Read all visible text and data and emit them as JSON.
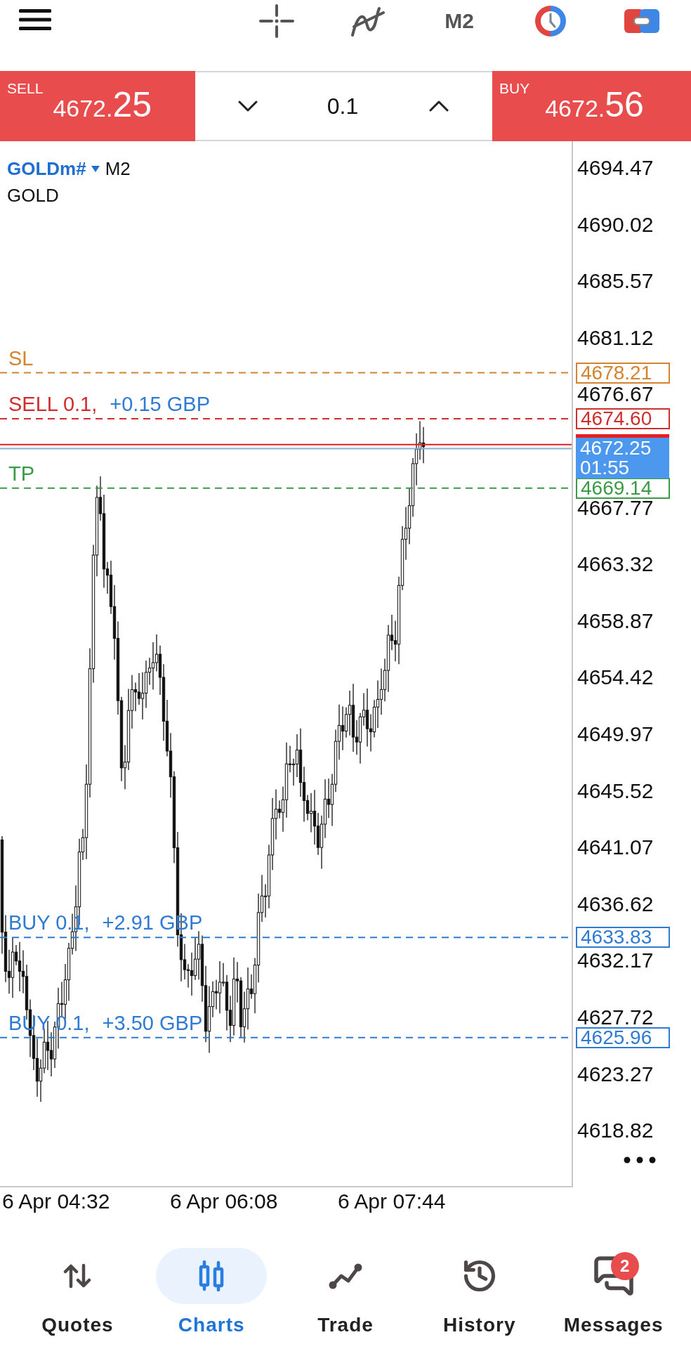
{
  "toolbar": {
    "timeframe": "M2"
  },
  "trade_panel": {
    "sell": {
      "label": "SELL",
      "price": "4672.",
      "pips": "25"
    },
    "volume": "0.1",
    "buy": {
      "label": "BUY",
      "price": "4672.",
      "pips": "56"
    }
  },
  "chart": {
    "symbol": "GOLDm#",
    "timeframe": "M2",
    "description": "GOLD",
    "order_lines": [
      {
        "kind": "sl",
        "label": "SL",
        "price": "4678.21"
      },
      {
        "kind": "sell",
        "label": "SELL 0.1,",
        "profit": "+0.15 GBP",
        "price": "4674.60"
      },
      {
        "kind": "tp",
        "label": "TP",
        "price": "4669.14"
      },
      {
        "kind": "buy",
        "label": "BUY 0.1,",
        "profit": "+2.91 GBP",
        "price": "4633.83"
      },
      {
        "kind": "buy",
        "label": "BUY 0.1,",
        "profit": "+3.50 GBP",
        "price": "4625.96"
      }
    ],
    "current_price": {
      "bid": "4672.25",
      "countdown": "01:55"
    },
    "price_axis": [
      "4694.47",
      "4690.02",
      "4685.57",
      "4681.12",
      "4676.67",
      "4667.77",
      "4663.32",
      "4658.87",
      "4654.42",
      "4649.97",
      "4645.52",
      "4641.07",
      "4636.62",
      "4632.17",
      "4627.72",
      "4623.27",
      "4618.82"
    ],
    "time_axis": [
      "6 Apr 04:32",
      "6 Apr 06:08",
      "6 Apr 07:44"
    ]
  },
  "bottom_nav": [
    {
      "label": "Quotes",
      "selected": false
    },
    {
      "label": "Charts",
      "selected": true
    },
    {
      "label": "Trade",
      "selected": false
    },
    {
      "label": "History",
      "selected": false
    },
    {
      "label": "Messages",
      "selected": false,
      "badge": "2"
    }
  ]
}
